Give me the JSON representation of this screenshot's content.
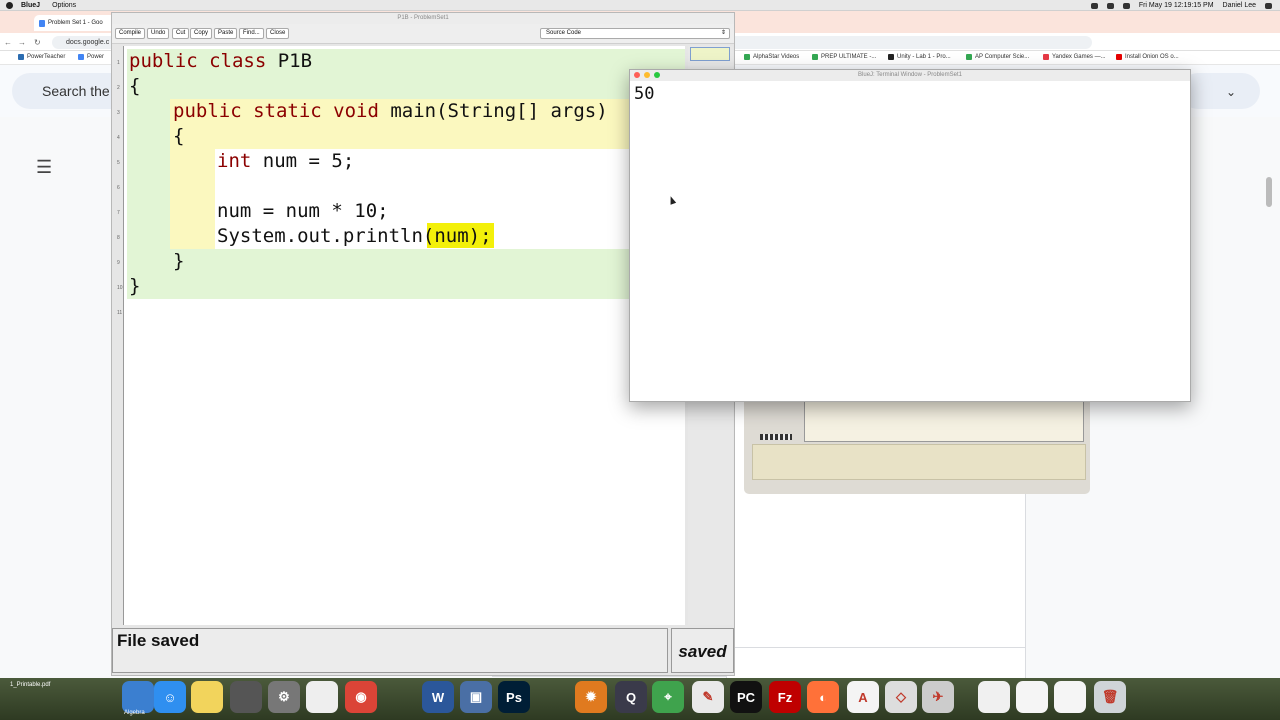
{
  "menubar": {
    "app": "BlueJ",
    "options": "Options",
    "datetime": "Fri May 19  12:19:15 PM",
    "user": "Daniel Lee"
  },
  "chrome": {
    "tab_title": "Problem Set 1 - Goo",
    "url": "docs.google.c",
    "bookmarks": [
      {
        "label": "PowerTeacher",
        "color": "#2b6cb0"
      },
      {
        "label": "Power",
        "color": "#4285f4"
      },
      {
        "label": "AlphaStar Videos",
        "color": "#34a853"
      },
      {
        "label": "PREP ULTIMATE -...",
        "color": "#34a853"
      },
      {
        "label": "Unity - Lab 1 - Pro...",
        "color": "#222222"
      },
      {
        "label": "AP Computer Scie...",
        "color": "#34a853"
      },
      {
        "label": "Yandex Games —...",
        "color": "#e63946"
      },
      {
        "label": "Install Onion OS o...",
        "color": "#e60000"
      }
    ],
    "search_placeholder": "Search the",
    "outline_icon": "☰"
  },
  "editor": {
    "title": "P1B - ProblemSet1",
    "toolbar": [
      "Compile",
      "Undo",
      "Cut",
      "Copy",
      "Paste",
      "Find...",
      "Close"
    ],
    "view_select": "Source Code",
    "line_numbers": [
      "1",
      "2",
      "3",
      "4",
      "5",
      "6",
      "7",
      "8",
      "9",
      "10",
      "11"
    ],
    "status": "File saved",
    "saved_label": "saved",
    "colors": {
      "class_scope": "#e2f5d5",
      "method_scope": "#fbf8bf",
      "highlight": "#f3f00a",
      "keyword": "#8b0000"
    }
  },
  "code": {
    "l1_kw": "public class",
    "l1_name": " P1B",
    "l2": "{",
    "l3_kw": "public static void",
    "l3_rest": " main(String[] args)",
    "l4": "{",
    "l5_kw": "int",
    "l5_rest": " num = 5;",
    "l7": "num = num * 10;",
    "l8_pre": "System.out.println",
    "l8_hl": "(num);",
    "l9": "}",
    "l10": "}"
  },
  "terminal": {
    "title": "BlueJ: Terminal Window - ProblemSet1",
    "output": "50"
  },
  "dock": {
    "apps": [
      {
        "name": "Algebra",
        "glyph": "",
        "color": "#3b7fd0"
      },
      {
        "name": "Finder",
        "glyph": "☺",
        "color": "#2f8ff0"
      },
      {
        "name": "Notes",
        "glyph": "",
        "color": "#f2d45c"
      },
      {
        "name": "Calculator",
        "glyph": "",
        "color": "#555555"
      },
      {
        "name": "System Preferences",
        "glyph": "⚙",
        "color": "#777777"
      },
      {
        "name": "TextEdit",
        "glyph": "",
        "color": "#eeeeee"
      },
      {
        "name": "Chrome",
        "glyph": "◉",
        "color": "#db4437"
      },
      {
        "name": "Word",
        "glyph": "W",
        "color": "#2b579a"
      },
      {
        "name": "Preview",
        "glyph": "▣",
        "color": "#4a6fa5"
      },
      {
        "name": "Photoshop",
        "glyph": "Ps",
        "color": "#001e36"
      },
      {
        "name": "Settings",
        "glyph": "✹",
        "color": "#e07a1f"
      },
      {
        "name": "QuickTime",
        "glyph": "Q",
        "color": "#3a3a4a"
      },
      {
        "name": "Maps",
        "glyph": "⌖",
        "color": "#3fa34d"
      },
      {
        "name": "Inkscape",
        "glyph": "✎",
        "color": "#e9e9e9"
      },
      {
        "name": "PyCharm",
        "glyph": "PC",
        "color": "#111111"
      },
      {
        "name": "FileZilla",
        "glyph": "Fz",
        "color": "#bf0000"
      },
      {
        "name": "Firefox",
        "glyph": "◐",
        "color": "#ff7139"
      },
      {
        "name": "Acrobat",
        "glyph": "A",
        "color": "#f4f4f4"
      },
      {
        "name": "Unity",
        "glyph": "◇",
        "color": "#dddddd"
      },
      {
        "name": "BlueJ",
        "glyph": "✈",
        "color": "#cccccc"
      },
      {
        "name": "Document",
        "glyph": "",
        "color": "#f0f0f0"
      },
      {
        "name": "Screenshot",
        "glyph": "",
        "color": "#f5f5f5"
      },
      {
        "name": "Screenshot2",
        "glyph": "",
        "color": "#f5f5f5"
      },
      {
        "name": "Trash",
        "glyph": "🗑",
        "color": "#cfd4d8"
      }
    ],
    "left_label": "Algebra",
    "file_label": "1_Printable.pdf"
  }
}
